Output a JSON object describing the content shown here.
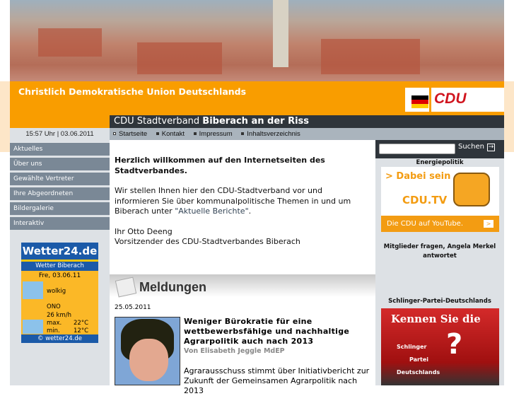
{
  "header": {
    "org_name": "Christlich Demokratische Union Deutschlands",
    "logo_text": "CDU",
    "site_title_prefix": "CDU Stadtverband",
    "site_title_name": "Biberach an der Riss"
  },
  "datetime": "15:57 Uhr | 03.06.2011",
  "top_nav": [
    "Startseite",
    "Kontakt",
    "Impressum",
    "Inhaltsverzeichnis"
  ],
  "side_menu": [
    "Aktuelles",
    "Über uns",
    "Gewählte Vertreter",
    "Ihre Abgeordneten",
    "Bildergalerie",
    "Interaktiv"
  ],
  "weather": {
    "brand": "Wetter24.de",
    "location": "Wetter Biberach",
    "date": "Fre, 03.06.11",
    "condition": "wolkig",
    "wind_dir": "ONO",
    "wind_speed": "26 km/h",
    "max_label": "max.",
    "max": "22°C",
    "min_label": "min.",
    "min": "12°C",
    "footer": "© wetter24.de"
  },
  "welcome": {
    "heading": "Herzlich willkommen auf den Internetseiten des Stadtverbandes.",
    "text_before": "Wir stellen Ihnen hier den CDU-Stadtverband vor und informieren Sie über kommunalpolitische Themen in und um Biberach unter ",
    "link": "\"Aktuelle Berichte\"",
    "text_after": ".",
    "sign1": "Ihr Otto Deeng",
    "sign2": "Vorsitzender des CDU-Stadtverbandes Biberach"
  },
  "news": {
    "section_title": "Meldungen",
    "date": "25.05.2011",
    "headline": "Weniger Bürokratie für eine wettbewerbsfähige und nachhaltige Agrarpolitik auch nach 2013",
    "byline": "Von Elisabeth Jeggle MdEP",
    "teaser": "Agrarausschuss stimmt über Initiativbericht zur Zukunft der Gemeinsamen Agrarpolitik nach 2013"
  },
  "search": {
    "value": "",
    "button": "Suchen"
  },
  "right": {
    "energie_title": "Energiepolitik",
    "tv_dabei": "> Dabei sein",
    "tv_logo": "CDU.TV",
    "tv_bar": "Die CDU auf YouTube.",
    "merkel_title": "Mitglieder fragen, Angela Merkel antwortet",
    "spd_title": "Schlinger-Partei-Deutschlands",
    "spd_banner": "Kennen Sie die",
    "spd_l1": "Schlinger",
    "spd_l2": "Partei",
    "spd_l3": "Deutschlands"
  }
}
